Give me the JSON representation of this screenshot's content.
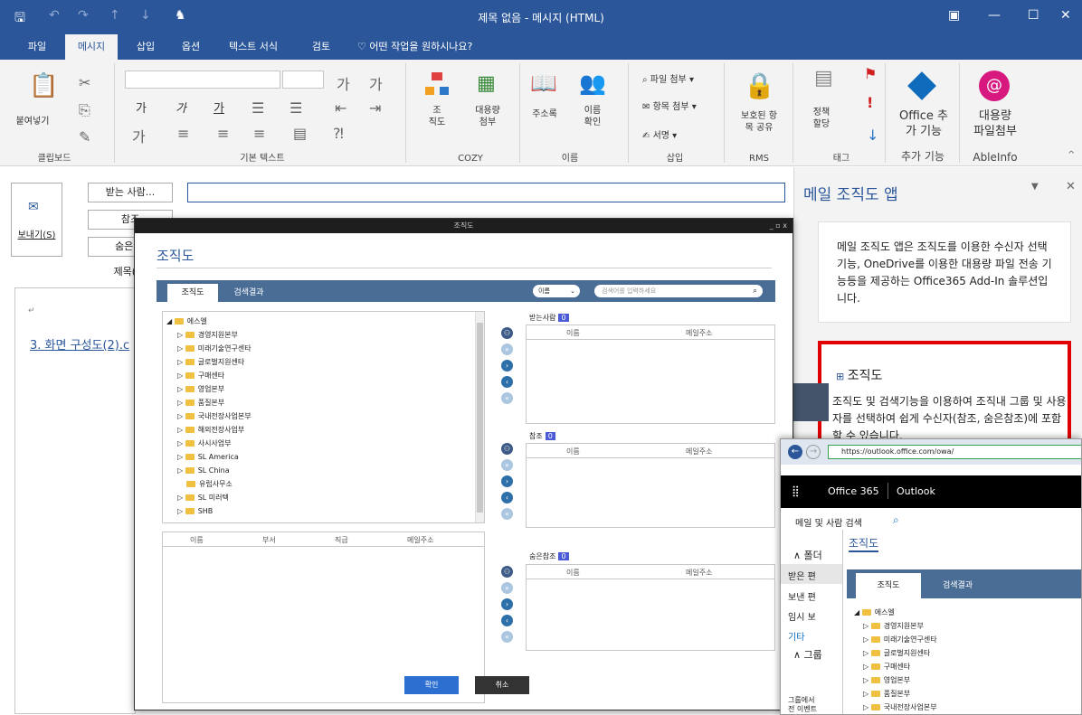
{
  "window": {
    "title": "제목 없음 - 메시지 (HTML)"
  },
  "menu": {
    "tabs": [
      "파일",
      "메시지",
      "삽입",
      "옵션",
      "텍스트 서식",
      "검토"
    ],
    "tell_me": "어떤 작업을 원하시나요?"
  },
  "ribbon": {
    "paste": "붙여넣기",
    "clipboard": "클립보드",
    "format_row1": [
      "가",
      "가",
      "가"
    ],
    "basic_text": "기본 텍스트",
    "org": "조\n직도",
    "bigfile": "대용량\n첨부",
    "cozy": "COZY",
    "addressbook": "주소록",
    "checkname": "이름\n확인",
    "names": "이름",
    "attach_file": "파일 첨부",
    "attach_item": "항목 첨부",
    "signature": "서명",
    "insert": "삽입",
    "protected": "보호된 항\n목 공유",
    "rms": "RMS",
    "policy": "정책\n할당",
    "tags": "태그",
    "office_addin": "Office 추\n가 기능",
    "addins": "추가 기능",
    "bigfile2": "대용량\n파일첨부",
    "ableinfo": "AbleInfo"
  },
  "compose": {
    "to": "받는 사람...",
    "cc": "참조",
    "bcc": "숨은 참",
    "send": "보내기(S)",
    "subject": "제목(U)",
    "body_link": "3. 화면 구성도(2).c"
  },
  "pane": {
    "title": "메일 조직도 앱",
    "desc": "메일 조직도 앱은 조직도를 이용한 수신자 선택기능, OneDrive를 이용한 대용량 파일 전송 기능등을 제공하는 Office365 Add-In 솔루션입니다.",
    "org_title": "조직도",
    "org_desc": "조직도 및 검색기능을 이용하여 조직내 그룹 및 사용자를 선택하여 쉽게 수신자(참조, 숨은참조)에 포함할 수 있습니다."
  },
  "dialog": {
    "titlebar": "조직도",
    "heading": "조직도",
    "tabs": [
      "조직도",
      "검색결과"
    ],
    "search_select": "이름",
    "search_placeholder": "검색어를 입력하세요",
    "tree_root": "에스엘",
    "tree": [
      "경영지원본부",
      "미래기술연구센타",
      "글로벌지원센타",
      "구매센타",
      "영업본부",
      "품질본부",
      "국내전장사업본부",
      "해외전장사업부",
      "사시사업부",
      "SL America",
      "SL China",
      "유럽사무소",
      "SL 미러텍",
      "SHB"
    ],
    "list_headers": [
      "이름",
      "부서",
      "직급",
      "메일주소"
    ],
    "to_label": "받는사람",
    "cc_label": "참조",
    "bcc_label": "숨은참조",
    "count": "0",
    "col_name": "이름",
    "col_mail": "메일주소",
    "ok": "확인",
    "cancel": "취소"
  },
  "owa": {
    "url": "https://outlook.office.com/owa/",
    "brand": "Office 365",
    "app": "Outlook",
    "search": "메일 및 사람 검색",
    "folder": "∧ 폴더",
    "inbox": "받은 편",
    "sent": "보낸 편",
    "drafts": "임시 보",
    "other": "기타",
    "groups": "∧ 그룹",
    "foot": "그룹에서\n전 이벤트",
    "org": "조직도",
    "tabs": [
      "조직도",
      "검색결과"
    ],
    "tree_root": "에스엘",
    "tree": [
      "경영지원본부",
      "미래기술연구센타",
      "글로벌지원센타",
      "구매센타",
      "영업본부",
      "품질본부",
      "국내전장사업본부"
    ]
  }
}
